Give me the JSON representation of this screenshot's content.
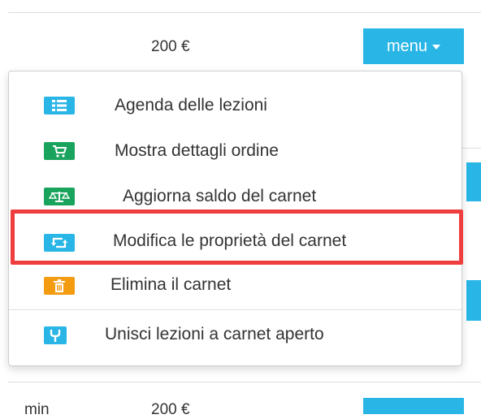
{
  "row1": {
    "price": "200 €",
    "menu_label": "menu"
  },
  "dropdown": {
    "items": [
      {
        "label": "Agenda delle lezioni",
        "icon": "list-icon",
        "color": "#29b6e6"
      },
      {
        "label": "Mostra dettagli ordine",
        "icon": "cart-icon",
        "color": "#1aa35c"
      },
      {
        "label": "Aggiorna saldo del carnet",
        "icon": "balance-scale-icon",
        "color": "#1aa35c"
      },
      {
        "label": "Modifica le proprietà del carnet",
        "icon": "retweet-icon",
        "color": "#29b6e6"
      },
      {
        "label": "Elimina il carnet",
        "icon": "trash-icon",
        "color": "#f39c12"
      },
      {
        "label": "Unisci lezioni a carnet aperto",
        "icon": "merge-icon",
        "color": "#29b6e6"
      }
    ]
  },
  "row2": {
    "left_text": "min",
    "price": "200 €"
  },
  "colors": {
    "accent": "#29b6e6",
    "highlight": "#ef3e3e"
  }
}
